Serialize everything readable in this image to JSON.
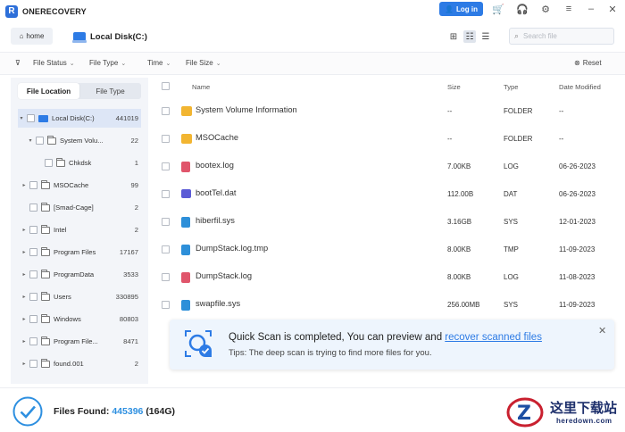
{
  "app": {
    "name": "ONERECOVERY",
    "logo_letter": "R"
  },
  "header": {
    "login_label": "Log in"
  },
  "nav": {
    "home_label": "home",
    "current_location": "Local Disk(C:)",
    "search_placeholder": "Search file"
  },
  "filters": {
    "file_status": "File Status",
    "file_type": "File Type",
    "time": "Time",
    "file_size": "File Size",
    "reset": "Reset"
  },
  "sidebar": {
    "tabs": [
      "File Location",
      "File Type"
    ],
    "tree": [
      {
        "name": "Local Disk(C:)",
        "count": "441019"
      },
      {
        "name": "System Volu...",
        "count": "22"
      },
      {
        "name": "Chkdsk",
        "count": "1"
      },
      {
        "name": "MSOCache",
        "count": "99"
      },
      {
        "name": "[Smad-Cage]",
        "count": "2"
      },
      {
        "name": "Intel",
        "count": "2"
      },
      {
        "name": "Program Files",
        "count": "17167"
      },
      {
        "name": "ProgramData",
        "count": "3533"
      },
      {
        "name": "Users",
        "count": "330895"
      },
      {
        "name": "Windows",
        "count": "80803"
      },
      {
        "name": "Program File...",
        "count": "8471"
      },
      {
        "name": "found.001",
        "count": "2"
      }
    ]
  },
  "table": {
    "columns": [
      "Name",
      "Size",
      "Type",
      "Date Modified"
    ],
    "rows": [
      {
        "name": "System Volume Information",
        "size": "--",
        "type": "FOLDER",
        "date": "--",
        "icon": "folder-icon"
      },
      {
        "name": "MSOCache",
        "size": "--",
        "type": "FOLDER",
        "date": "--",
        "icon": "folder-icon"
      },
      {
        "name": "bootex.log",
        "size": "7.00KB",
        "type": "LOG",
        "date": "06-26-2023",
        "icon": "log-file-icon"
      },
      {
        "name": "bootTel.dat",
        "size": "112.00B",
        "type": "DAT",
        "date": "06-26-2023",
        "icon": "dat-file-icon"
      },
      {
        "name": "hiberfil.sys",
        "size": "3.16GB",
        "type": "SYS",
        "date": "12-01-2023",
        "icon": "sys-file-icon"
      },
      {
        "name": "DumpStack.log.tmp",
        "size": "8.00KB",
        "type": "TMP",
        "date": "11-09-2023",
        "icon": "tmp-file-icon"
      },
      {
        "name": "DumpStack.log",
        "size": "8.00KB",
        "type": "LOG",
        "date": "11-08-2023",
        "icon": "log-file-icon"
      },
      {
        "name": "swapfile.sys",
        "size": "256.00MB",
        "type": "SYS",
        "date": "11-09-2023",
        "icon": "sys-file-icon"
      }
    ]
  },
  "notice": {
    "title_prefix": "Quick Scan is completed, You can preview and ",
    "title_link": "recover scanned files",
    "subtitle": "Tips: The deep scan is trying to find more files for you."
  },
  "footer": {
    "label": "Files Found:",
    "count": "445396",
    "size": "(164G)"
  },
  "watermark": {
    "cn": "这里下载站",
    "en": "heredown.com",
    "letter": "Z"
  },
  "colors": {
    "accent": "#2d7be5",
    "folder": "#f2b531",
    "log": "#e0556b",
    "dat": "#5b5bd6",
    "sys": "#2d8fd9"
  }
}
